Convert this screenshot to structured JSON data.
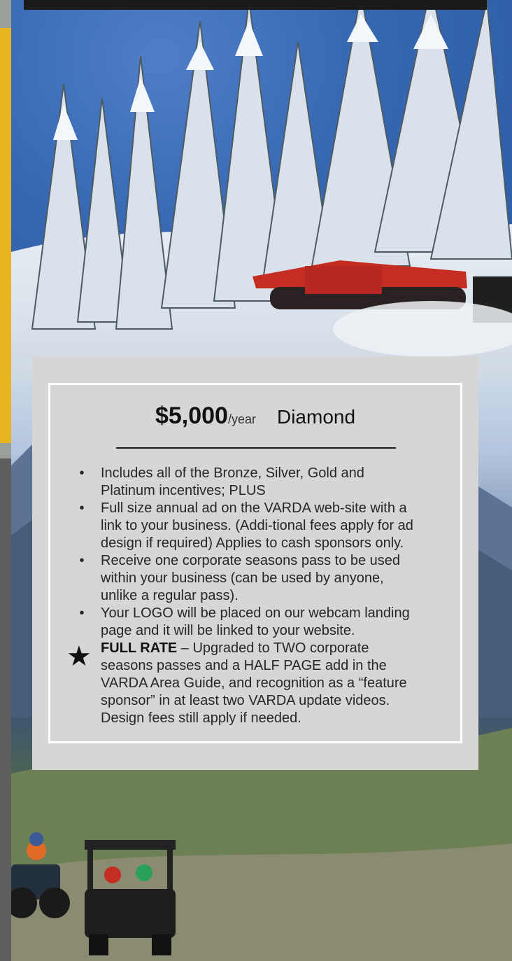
{
  "card": {
    "price": "$5,000",
    "per": "/year",
    "tier": "Diamond",
    "bullets": [
      "Includes all of the Bronze, Silver, Gold and Platinum incentives; PLUS",
      "Full size annual ad on the VARDA web-site with a link to your business. (Addi-tional fees apply for ad design if required) Applies to cash sponsors only.",
      "Receive one corporate seasons pass to be used within your business (can be used by anyone, unlike a regular pass).",
      "Your LOGO will be placed on our webcam landing page and it will be linked to your website."
    ],
    "bullet_symbol": "•",
    "star_symbol": "★",
    "full_rate_label": "FULL RATE",
    "full_rate_text": " – Upgraded to TWO corporate seasons passes and a HALF PAGE add in the VARDA Area Guide, and recognition as a “feature sponsor” in at least two VARDA update videos. Design fees still apply if needed."
  },
  "colors": {
    "accent_yellow": "#e9b31f",
    "accent_gray": "#5e5e5e",
    "card_bg": "#d6d6d6",
    "card_border": "#ffffff"
  }
}
